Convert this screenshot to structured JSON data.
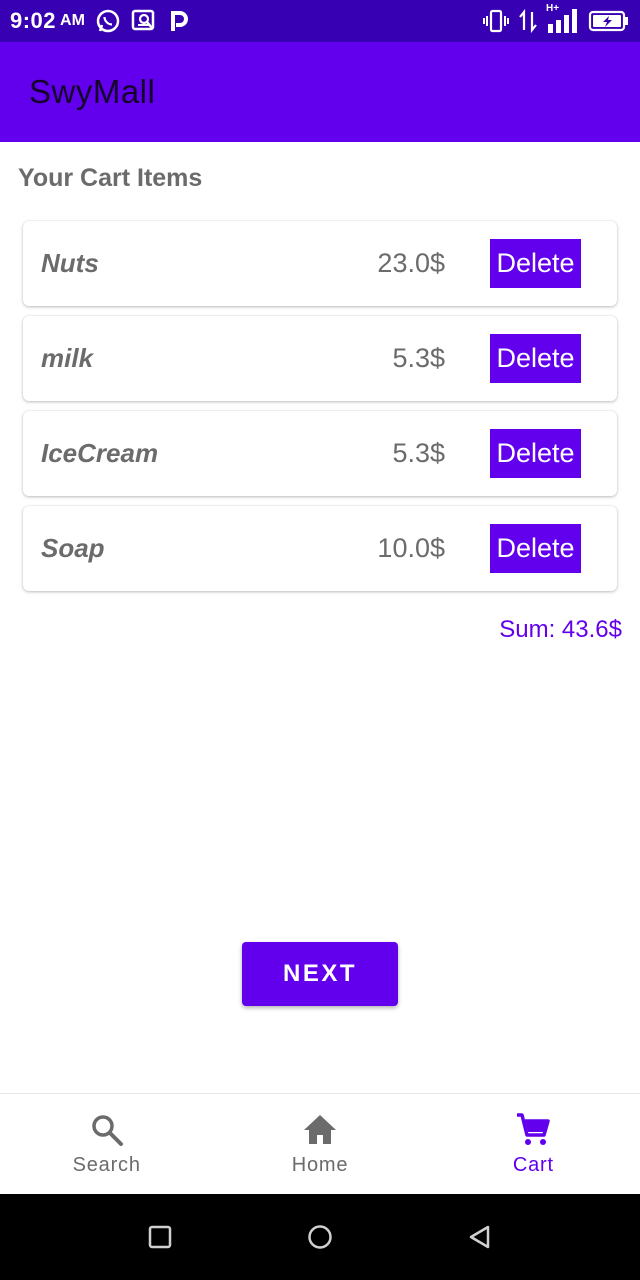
{
  "status_bar": {
    "time": "9:02",
    "ampm": "AM",
    "left_icons": [
      "whatsapp-icon",
      "app-notification-icon",
      "p-app-icon"
    ],
    "right_icons": [
      "vibrate-icon",
      "data-arrows-icon",
      "signal-hplus-icon",
      "battery-charging-icon"
    ],
    "network_label": "H+"
  },
  "app_bar": {
    "title": "SwyMall"
  },
  "cart": {
    "title": "Your Cart Items",
    "items": [
      {
        "name": "Nuts",
        "price": "23.0$",
        "delete_label": "Delete"
      },
      {
        "name": "milk",
        "price": "5.3$",
        "delete_label": "Delete"
      },
      {
        "name": "IceCream",
        "price": "5.3$",
        "delete_label": "Delete"
      },
      {
        "name": "Soap",
        "price": "10.0$",
        "delete_label": "Delete"
      }
    ],
    "sum": "Sum: 43.6$"
  },
  "next_button": {
    "label": "NEXT"
  },
  "bottom_nav": {
    "items": [
      {
        "label": "Search",
        "icon": "search-icon",
        "active": false
      },
      {
        "label": "Home",
        "icon": "home-icon",
        "active": false
      },
      {
        "label": "Cart",
        "icon": "cart-icon",
        "active": true
      }
    ]
  },
  "system_nav": {
    "buttons": [
      "recents-icon",
      "home-circle-icon",
      "back-icon"
    ]
  },
  "colors": {
    "primary": "#6200ee",
    "primary_dark": "#3700b3",
    "text_gray": "#6b6b6b",
    "title_dark": "#14002b"
  }
}
